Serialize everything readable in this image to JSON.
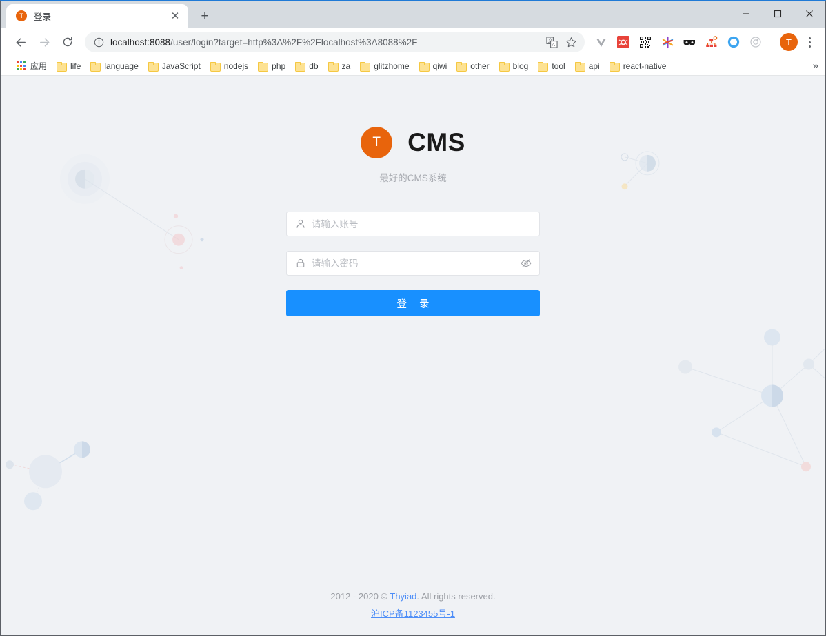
{
  "browser": {
    "tab": {
      "title": "登录",
      "favicon_letter": "T",
      "favicon_color": "#e8640c",
      "close_label": "✕"
    },
    "new_tab_label": "+",
    "window_controls": {
      "minimize": "minimize-icon",
      "maximize": "maximize-icon",
      "close": "close-icon"
    },
    "nav": {
      "back": "back-arrow-icon",
      "forward": "forward-arrow-icon",
      "reload": "reload-icon"
    },
    "omnibox": {
      "url_host": "localhost:8088",
      "url_path": "/user/login?target=http%3A%2F%2Flocalhost%3A8088%2F",
      "full_url": "localhost:8088/user/login?target=http%3A%2F%2Flocalhost%3A8088%2F",
      "info_icon": "site-info-icon",
      "translate_icon": "translate-icon",
      "bookmark_icon": "star-icon"
    },
    "extensions": [
      {
        "name": "vue-devtools-extension",
        "glyph": "V",
        "color": "#a0a3a8"
      },
      {
        "name": "red-bug-extension",
        "glyph": "",
        "color": "#e8433a"
      },
      {
        "name": "qrcode-extension",
        "glyph": "",
        "color": "#2b2b2b"
      },
      {
        "name": "colorful-star-extension",
        "glyph": "",
        "color": "#8e44c8"
      },
      {
        "name": "dark-glasses-extension",
        "glyph": "",
        "color": "#1a1a1a"
      },
      {
        "name": "sitemap-extension",
        "glyph": "",
        "color": "#e8640c"
      },
      {
        "name": "blue-circle-extension",
        "glyph": "",
        "color": "#3da5f0"
      },
      {
        "name": "gray-target-extension",
        "glyph": "",
        "color": "#b4b7bc"
      }
    ],
    "profile": {
      "letter": "T",
      "color": "#e8640c"
    },
    "menu_label": "chrome-menu-icon",
    "bookmarks": {
      "apps_label": "应用",
      "items": [
        {
          "label": "life"
        },
        {
          "label": "language"
        },
        {
          "label": "JavaScript"
        },
        {
          "label": "nodejs"
        },
        {
          "label": "php"
        },
        {
          "label": "db"
        },
        {
          "label": "za"
        },
        {
          "label": "glitzhome"
        },
        {
          "label": "qiwi"
        },
        {
          "label": "other"
        },
        {
          "label": "blog"
        },
        {
          "label": "tool"
        },
        {
          "label": "api"
        },
        {
          "label": "react-native"
        }
      ],
      "overflow_label": "»"
    }
  },
  "login": {
    "brand": {
      "logo_letter": "T",
      "logo_color": "#e8640c",
      "name": "CMS",
      "description": "最好的CMS系统"
    },
    "username": {
      "placeholder": "请输入账号",
      "value": "",
      "icon": "user-icon"
    },
    "password": {
      "placeholder": "请输入密码",
      "value": "",
      "icon": "lock-icon",
      "toggle_icon": "eye-off-icon"
    },
    "submit_label": "登 录",
    "accent_color": "#1890ff"
  },
  "footer": {
    "copyright_prefix": "2012 - 2020 © ",
    "company": "Thyiad",
    "copyright_suffix": ". All rights reserved.",
    "icp": "沪ICP备1123455号-1"
  },
  "theme": {
    "page_background": "#f0f2f5",
    "primary": "#1890ff",
    "brand_orange": "#e8640c",
    "link_blue": "#4e8ef7"
  }
}
